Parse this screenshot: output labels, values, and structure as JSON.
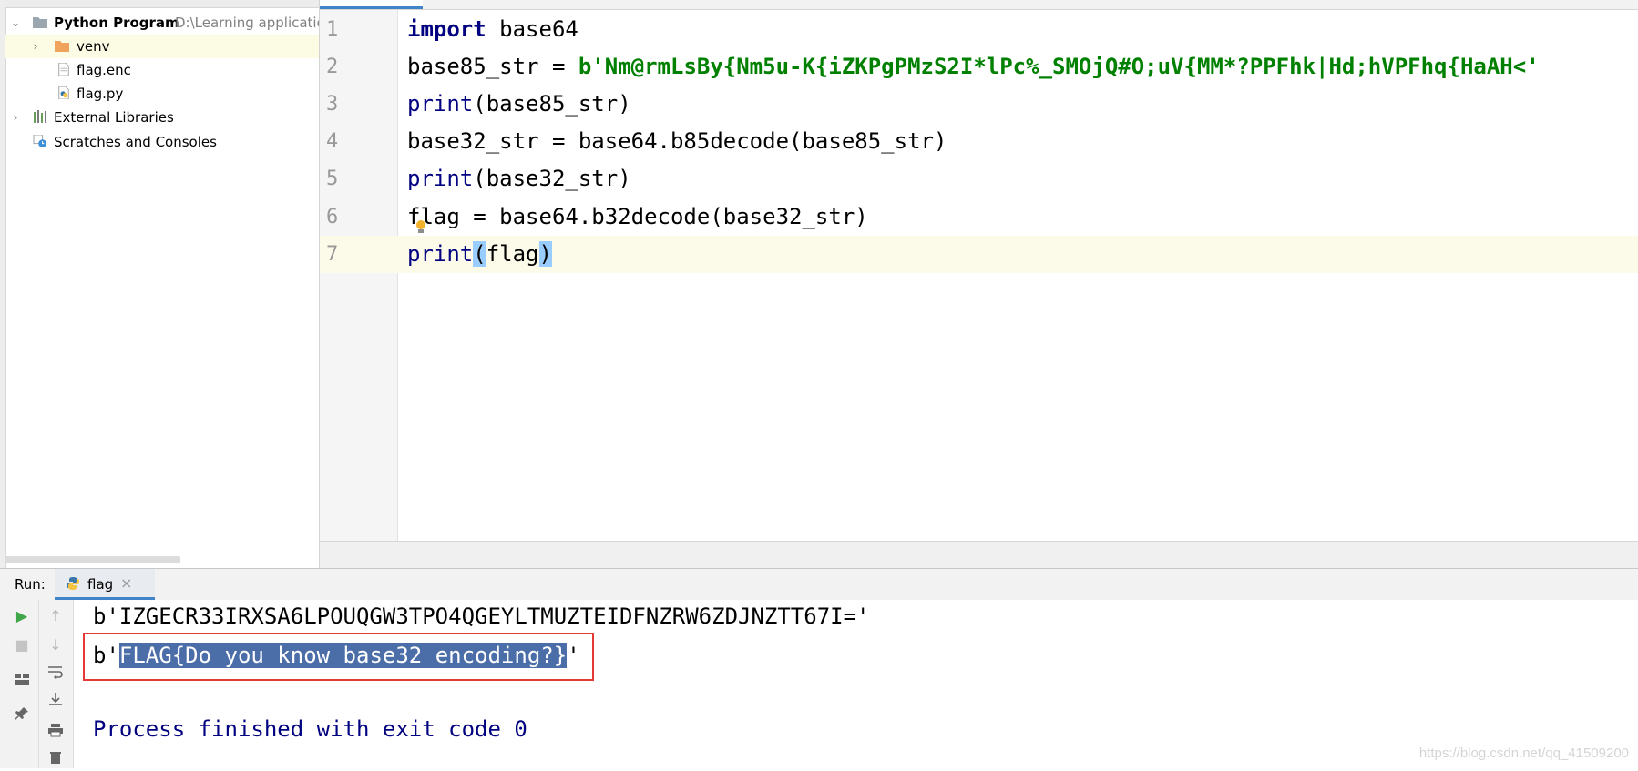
{
  "project": {
    "root_name": "Python Program",
    "root_path": "D:\\Learning applicatio",
    "items": [
      {
        "label": "venv"
      },
      {
        "label": "flag.enc"
      },
      {
        "label": "flag.py"
      },
      {
        "label": "External Libraries"
      },
      {
        "label": "Scratches and Consoles"
      }
    ]
  },
  "editor": {
    "line_numbers": [
      "1",
      "2",
      "3",
      "4",
      "5",
      "6",
      "7"
    ],
    "lines": {
      "l1": {
        "kw": "import",
        "rest": " base64"
      },
      "l2": {
        "pre": "base85_str = ",
        "str": "b'Nm@rmLsBy{Nm5u-K{iZKPgPMzS2I*lPc%_SMOjQ#O;uV{MM*?PPFhk|Hd;hVPFhq{HaAH<'"
      },
      "l3": {
        "fn": "print",
        "rest": "(base85_str)"
      },
      "l4": {
        "text": "base32_str = base64.b85decode(base85_str)"
      },
      "l5": {
        "fn": "print",
        "rest": "(base32_str)"
      },
      "l6": {
        "text": "flag = base64.b32decode(base32_str)"
      },
      "l7": {
        "fn": "print",
        "open": "(",
        "arg": "flag",
        "close": ")"
      }
    }
  },
  "run": {
    "label": "Run:",
    "tab": "flag",
    "output": {
      "line1": "b'IZGECR33IRXSA6LPOUQGW3TPO4QGEYLTMUZTEIDFNZRW6ZDJNZTT67I='",
      "line2_prefix": "b'",
      "line2_selected": "FLAG{Do you know base32 encoding?}",
      "line2_suffix": "'",
      "line3": "Process finished with exit code 0"
    }
  },
  "watermark": "https://blog.csdn.net/qq_41509200"
}
